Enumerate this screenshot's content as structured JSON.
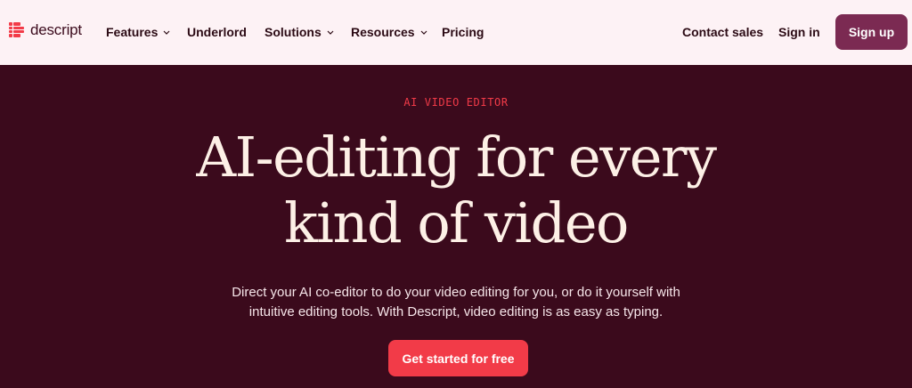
{
  "header": {
    "logo_text": "descript",
    "nav": [
      {
        "label": "Features",
        "has_dropdown": true
      },
      {
        "label": "Underlord",
        "has_dropdown": false
      },
      {
        "label": "Solutions",
        "has_dropdown": true
      },
      {
        "label": "Resources",
        "has_dropdown": true
      },
      {
        "label": "Pricing",
        "has_dropdown": false
      }
    ],
    "contact_sales": "Contact sales",
    "sign_in": "Sign in",
    "sign_up": "Sign up"
  },
  "hero": {
    "eyebrow": "AI VIDEO EDITOR",
    "headline_line1": "AI-editing for every",
    "headline_line2": "kind of video",
    "subtext_line1": "Direct your AI co-editor to do your video editing for you, or do it yourself with",
    "subtext_line2": "intuitive editing tools. With Descript, video editing is as easy as typing.",
    "cta": "Get started for free"
  },
  "colors": {
    "header_bg": "#fdf2f5",
    "hero_bg": "#3b0a1c",
    "accent_red": "#f23b48",
    "signup_bg": "#7b2a52",
    "headline_text": "#fdf0e6"
  }
}
